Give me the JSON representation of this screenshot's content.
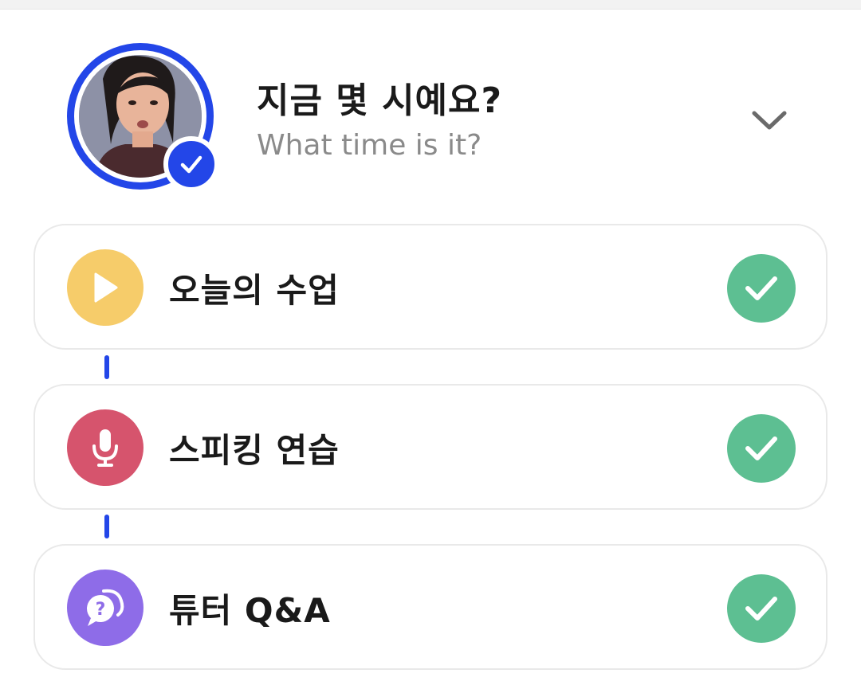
{
  "lesson": {
    "title": "지금 몇 시예요?",
    "subtitle": "What time is it?",
    "completed": true
  },
  "steps": [
    {
      "label": "오늘의 수업",
      "icon": "play-icon",
      "color": "#f6cc6a",
      "completed": true
    },
    {
      "label": "스피킹 연습",
      "icon": "microphone-icon",
      "color": "#d6546d",
      "completed": true
    },
    {
      "label": "튜터 Q&A",
      "icon": "chat-question-icon",
      "color": "#8e6ce8",
      "completed": true
    }
  ],
  "colors": {
    "accent": "#2346e8",
    "check": "#5dbf92",
    "title_text": "#1a1a1a",
    "subtitle_text": "#8a8a8a"
  }
}
